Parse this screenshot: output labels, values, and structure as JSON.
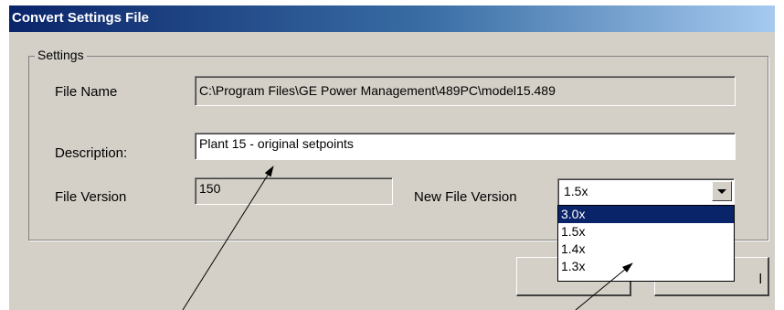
{
  "window": {
    "title": "Convert Settings File"
  },
  "settings": {
    "group_label": "Settings",
    "file_name_label": "File Name",
    "file_name_value": "C:\\Program Files\\GE Power Management\\489PC\\model15.489",
    "description_label": "Description:",
    "description_value": "Plant 15 - original setpoints",
    "file_version_label": "File Version",
    "file_version_value": "150",
    "new_file_version_label": "New File Version",
    "new_file_version_selected": "1.5x",
    "new_file_version_options": [
      "3.0x",
      "1.5x",
      "1.4x",
      "1.3x"
    ],
    "highlighted_option": "3.0x"
  },
  "buttons": {
    "cancel_partial": "l"
  },
  "icons": {
    "dropdown": "chevron-down-icon"
  },
  "colors": {
    "title_start": "#0a246a",
    "title_end": "#a6caf0",
    "highlight": "#0a246a",
    "face": "#d4d0c8"
  }
}
